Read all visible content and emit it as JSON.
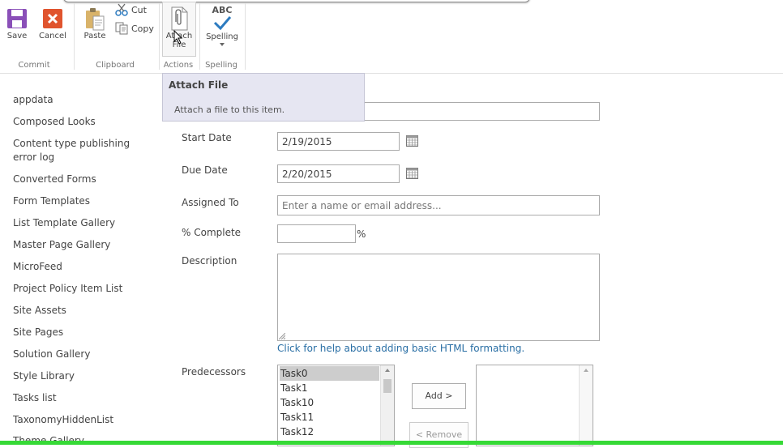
{
  "ribbon": {
    "commit": {
      "save_label": "Save",
      "cancel_label": "Cancel",
      "group_label": "Commit"
    },
    "clipboard": {
      "paste_label": "Paste",
      "cut_label": "Cut",
      "copy_label": "Copy",
      "group_label": "Clipboard"
    },
    "actions": {
      "attach_label_1": "Attach",
      "attach_label_2": "File",
      "group_label": "Actions"
    },
    "spelling": {
      "abc_text": "ABC",
      "spelling_label": "Spelling",
      "group_label": "Spelling"
    }
  },
  "tooltip": {
    "title": "Attach File",
    "description": "Attach a file to this item."
  },
  "nav": {
    "items": [
      "appdata",
      "Composed Looks",
      "Content type publishing",
      "error log",
      "Converted Forms",
      "Form Templates",
      "List Template Gallery",
      "Master Page Gallery",
      "MicroFeed",
      "Project Policy Item List",
      "Site Assets",
      "Site Pages",
      "Solution Gallery",
      "Style Library",
      "Tasks list",
      "TaxonomyHiddenList",
      "Theme Gallery"
    ]
  },
  "form": {
    "start_date": {
      "label": "Start Date",
      "value": "2/19/2015"
    },
    "due_date": {
      "label": "Due Date",
      "value": "2/20/2015"
    },
    "assigned_to": {
      "label": "Assigned To",
      "placeholder": "Enter a name or email address..."
    },
    "percent_complete": {
      "label": "% Complete",
      "value": "",
      "unit": "%"
    },
    "description": {
      "label": "Description",
      "help_link": "Click for help about adding basic HTML formatting."
    },
    "predecessors": {
      "label": "Predecessors",
      "options": [
        "Task0",
        "Task1",
        "Task10",
        "Task11",
        "Task12"
      ],
      "selected": "Task0",
      "add_label": "Add >",
      "remove_label": "< Remove"
    }
  },
  "colors": {
    "accent": "#2a6fa5",
    "save_purple": "#8a4fb8",
    "cancel_red": "#e0542e",
    "spell_blue": "#2c7bc0",
    "status_green": "#36d936"
  }
}
